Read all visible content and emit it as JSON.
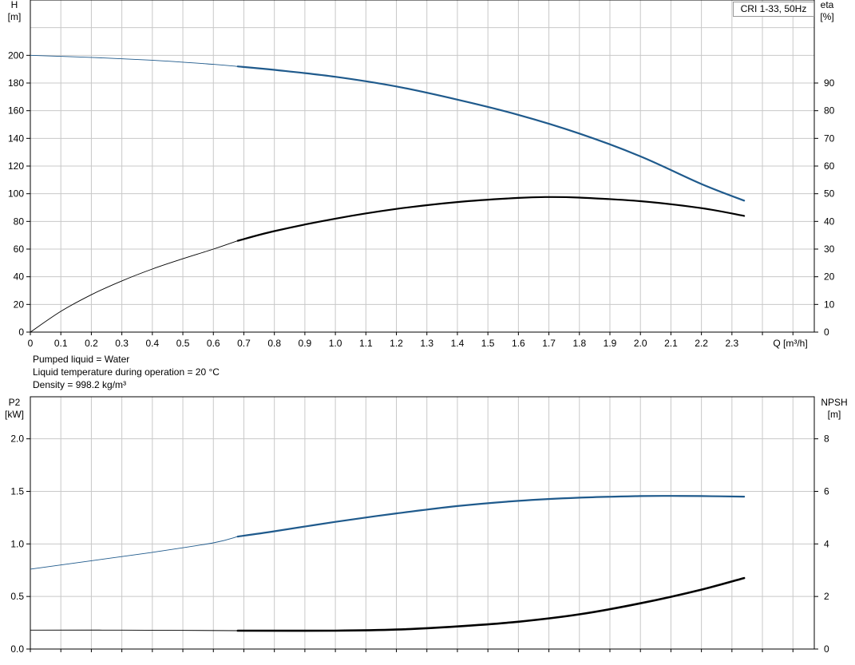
{
  "legend_label": "CRI 1-33, 50Hz",
  "info": {
    "liquid": "Pumped liquid = Water",
    "temperature": "Liquid temperature during operation = 20 °C",
    "density": "Density = 998.2 kg/m³"
  },
  "colors": {
    "blue": "#1f5a8c",
    "black": "#000000",
    "grid": "#c8c8c8"
  },
  "chart_data": [
    {
      "type": "line",
      "xlabel": "Q [m³/h]",
      "xlim": [
        0,
        2.57
      ],
      "x_ticks": [
        "0",
        "0.1",
        "0.2",
        "0.3",
        "0.4",
        "0.5",
        "0.6",
        "0.7",
        "0.8",
        "0.9",
        "1.0",
        "1.1",
        "1.2",
        "1.3",
        "1.4",
        "1.5",
        "1.6",
        "1.7",
        "1.8",
        "1.9",
        "2.0",
        "2.1",
        "2.2",
        "2.3"
      ],
      "ylabel_left": [
        "H",
        "[m]"
      ],
      "ylim_left": [
        0,
        240
      ],
      "y_ticks_left": [
        "0",
        "20",
        "40",
        "60",
        "80",
        "100",
        "120",
        "140",
        "160",
        "180",
        "200"
      ],
      "ylabel_right": [
        "eta",
        "[%]"
      ],
      "ylim_right": [
        0,
        120
      ],
      "y_ticks_right": [
        "0",
        "10",
        "20",
        "30",
        "40",
        "50",
        "60",
        "70",
        "80",
        "90"
      ],
      "grid": true,
      "series": [
        {
          "axis": "left",
          "color": "#1f5a8c",
          "duty_start": 0.68,
          "x": [
            0,
            0.2,
            0.4,
            0.6,
            0.68,
            0.8,
            1.0,
            1.2,
            1.4,
            1.6,
            1.8,
            2.0,
            2.2,
            2.34
          ],
          "y": [
            200,
            198.5,
            196.5,
            193.5,
            192,
            189.5,
            184.5,
            177.5,
            168,
            157,
            143.5,
            127,
            107,
            95
          ]
        },
        {
          "axis": "right",
          "color": "#000000",
          "duty_start": 0.68,
          "x": [
            0,
            0.1,
            0.2,
            0.3,
            0.4,
            0.5,
            0.6,
            0.68,
            0.8,
            1.0,
            1.2,
            1.4,
            1.6,
            1.7,
            1.8,
            2.0,
            2.2,
            2.34
          ],
          "y": [
            0,
            7.5,
            13.5,
            18.5,
            22.8,
            26.5,
            30,
            33,
            36.5,
            41,
            44.5,
            47,
            48.5,
            48.8,
            48.6,
            47.3,
            44.8,
            42
          ]
        }
      ]
    },
    {
      "type": "line",
      "xlim": [
        0,
        2.57
      ],
      "ylabel_left": [
        "P2",
        "[kW]"
      ],
      "ylim_left": [
        0,
        2.4
      ],
      "y_ticks_left": [
        "0.0",
        "0.5",
        "1.0",
        "1.5",
        "2.0"
      ],
      "ylabel_right": [
        "NPSH",
        "[m]"
      ],
      "ylim_right": [
        0,
        9.6
      ],
      "y_ticks_right": [
        "0",
        "2",
        "4",
        "6",
        "8"
      ],
      "grid": true,
      "series": [
        {
          "axis": "left",
          "color": "#1f5a8c",
          "duty_start": 0.68,
          "x": [
            0,
            0.2,
            0.4,
            0.6,
            0.68,
            0.8,
            1.0,
            1.2,
            1.4,
            1.6,
            1.8,
            2.0,
            2.1,
            2.2,
            2.34
          ],
          "y": [
            0.76,
            0.84,
            0.92,
            1.01,
            1.07,
            1.12,
            1.21,
            1.29,
            1.36,
            1.41,
            1.44,
            1.455,
            1.457,
            1.455,
            1.45
          ]
        },
        {
          "axis": "right",
          "color": "#000000",
          "duty_start": 0.68,
          "x": [
            0,
            0.3,
            0.68,
            1.0,
            1.2,
            1.4,
            1.6,
            1.8,
            2.0,
            2.2,
            2.34
          ],
          "y": [
            0.72,
            0.72,
            0.7,
            0.7,
            0.74,
            0.86,
            1.04,
            1.32,
            1.74,
            2.26,
            2.7
          ]
        }
      ]
    }
  ]
}
